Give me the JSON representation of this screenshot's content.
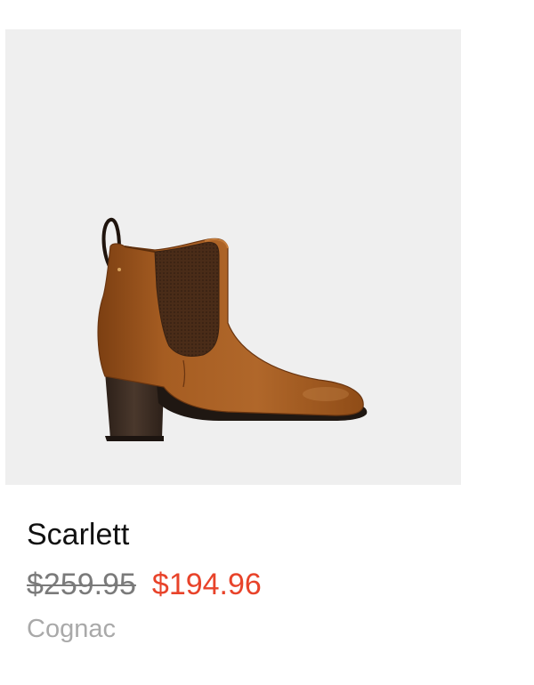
{
  "product": {
    "name": "Scarlett",
    "original_price": "$259.95",
    "sale_price": "$194.96",
    "color_name": "Cognac"
  },
  "colors": {
    "image_background": "#efefef",
    "leather": "#a0581e",
    "elastic": "#4a2c18",
    "heel": "#3a2a20",
    "sale_price": "#e8432a",
    "original_price": "#7a7a7a",
    "color_label": "#a9a9a9"
  }
}
